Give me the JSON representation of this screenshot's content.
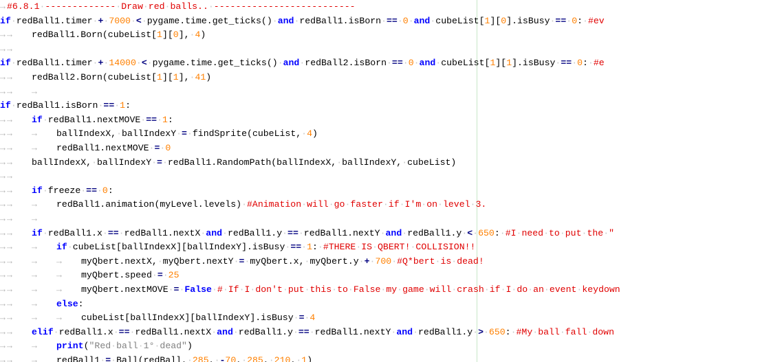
{
  "editor": {
    "lines": [
      "→#6.8.1 ------------- Draw red balls.. --------------------------",
      "if redBall1.timer + 7000 < pygame.time.get_ticks() and redBall1.isBorn == 0 and cubeList[1][0].isBusy == 0: #ev",
      "→→redBall1.Born(cubeList[1][0], 4)",
      "→→",
      "if redBall1.timer + 14000 < pygame.time.get_ticks() and redBall2.isBorn == 0 and cubeList[1][1].isBusy == 0: #e",
      "→→redBall2.Born(cubeList[1][1], 41)",
      "→→→",
      "if redBall1.isBorn == 1:",
      "→→if redBall1.nextMOVE == 1:",
      "→→→ballIndexX, ballIndexY = findSprite(cubeList, 4)",
      "→→→redBall1.nextMOVE = 0",
      "→→ballIndexX, ballIndexY = redBall1.RandomPath(ballIndexX, ballIndexY, cubeList)",
      "→→",
      "→→if freeze == 0:",
      "→→→redBall1.animation(myLevel.levels) #Animation will go faster if I'm on level 3.",
      "→→→",
      "→→if redBall1.x == redBall1.nextX and redBall1.y == redBall1.nextY and redBall1.y < 650: #I need to put the \"",
      "→→→if cubeList[ballIndexX][ballIndexY].isBusy == 1: #THERE IS QBERT! COLLISION!!",
      "→→→→myQbert.nextX, myQbert.nextY = myQbert.x, myQbert.y + 700 #Q*bert is dead!",
      "→→→→myQbert.speed = 25",
      "→→→→myQbert.nextMOVE = False # If I don't put this to False my game will crash if I do an event keydown",
      "→→→else:",
      "→→→→cubeList[ballIndexX][ballIndexY].isBusy = 4",
      "→→elif redBall1.x == redBall1.nextX and redBall1.y == redBall1.nextY and redBall1.y > 650: #My ball fall down",
      "→→→print(\"Red ball 1° dead\")",
      "→→→redBall1 = Ball(redBall, 285, -70, 285, 210, 1)"
    ]
  }
}
